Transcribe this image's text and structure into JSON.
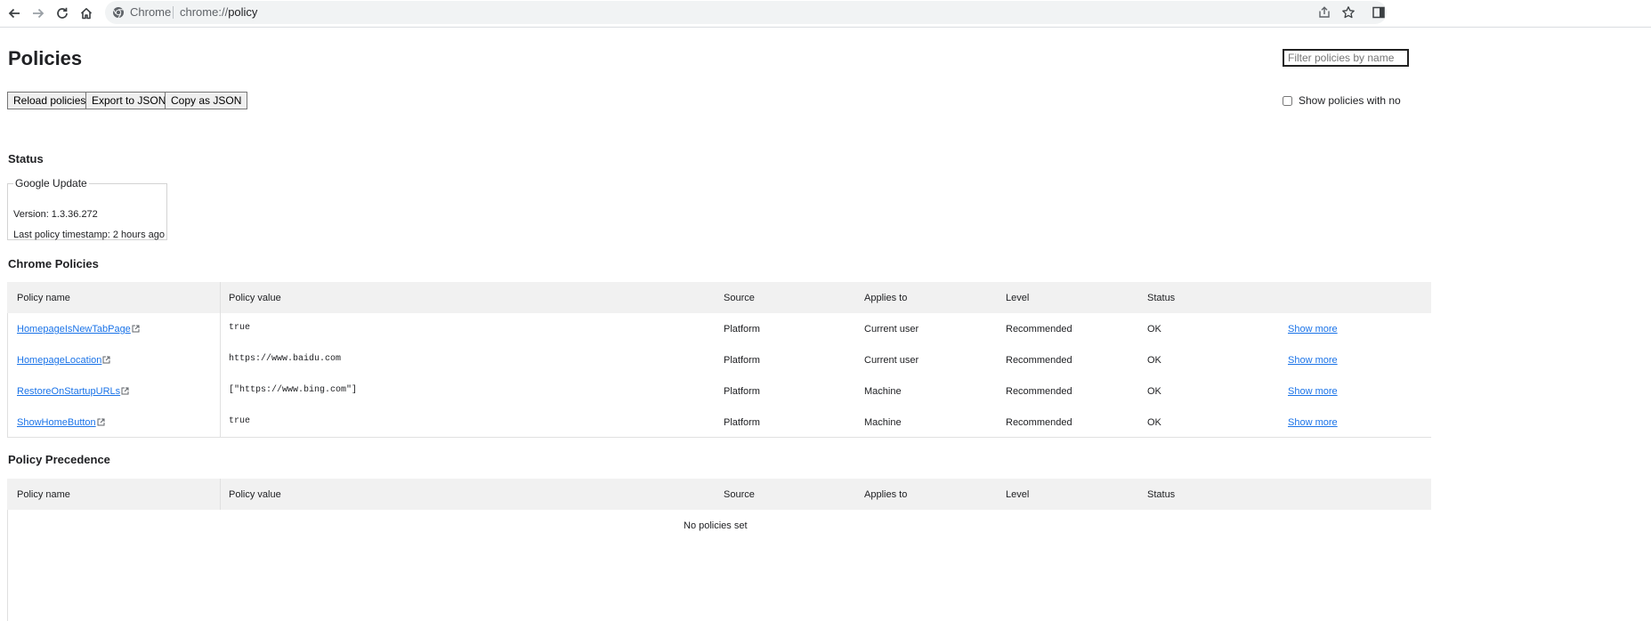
{
  "browser": {
    "site_label": "Chrome",
    "url_scheme": "chrome://",
    "url_path": "policy"
  },
  "page": {
    "title": "Policies",
    "filter_placeholder": "Filter policies by name",
    "buttons": {
      "reload": "Reload policies",
      "export": "Export to JSON",
      "copy": "Copy as JSON"
    },
    "show_unset_label": "Show policies with no"
  },
  "status": {
    "heading": "Status",
    "box_title": "Google Update",
    "version": "Version: 1.3.36.272",
    "timestamp": "Last policy timestamp: 2 hours ago"
  },
  "chrome_policies": {
    "heading": "Chrome Policies",
    "columns": [
      "Policy name",
      "Policy value",
      "Source",
      "Applies to",
      "Level",
      "Status"
    ],
    "rows": [
      {
        "name": "HomepageIsNewTabPage",
        "value": "true",
        "source": "Platform",
        "applies": "Current user",
        "level": "Recommended",
        "status": "OK",
        "more": "Show more"
      },
      {
        "name": "HomepageLocation",
        "value": "https://www.baidu.com",
        "source": "Platform",
        "applies": "Current user",
        "level": "Recommended",
        "status": "OK",
        "more": "Show more"
      },
      {
        "name": "RestoreOnStartupURLs",
        "value": "[\"https://www.bing.com\"]",
        "source": "Platform",
        "applies": "Machine",
        "level": "Recommended",
        "status": "OK",
        "more": "Show more"
      },
      {
        "name": "ShowHomeButton",
        "value": "true",
        "source": "Platform",
        "applies": "Machine",
        "level": "Recommended",
        "status": "OK",
        "more": "Show more"
      }
    ]
  },
  "precedence": {
    "heading": "Policy Precedence",
    "columns": [
      "Policy name",
      "Policy value",
      "Source",
      "Applies to",
      "Level",
      "Status"
    ],
    "empty_text": "No policies set"
  },
  "colors": {
    "link": "#1a73e8",
    "header_bg": "#f1f1f1"
  }
}
